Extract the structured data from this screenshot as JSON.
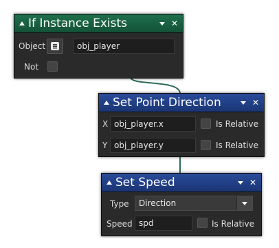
{
  "nodes": {
    "if_instance": {
      "title": "If Instance Exists",
      "object_label": "Object",
      "object_value": "obj_player",
      "not_label": "Not"
    },
    "set_point_direction": {
      "title": "Set Point Direction",
      "x_label": "X",
      "x_value": "obj_player.x",
      "x_relative_label": "Is Relative",
      "y_label": "Y",
      "y_value": "obj_player.y",
      "y_relative_label": "Is Relative"
    },
    "set_speed": {
      "title": "Set Speed",
      "type_label": "Type",
      "type_value": "Direction",
      "speed_label": "Speed",
      "speed_value": "spd",
      "speed_relative_label": "Is Relative"
    }
  },
  "colors": {
    "header_green": "#1f6f4c",
    "header_blue": "#2a4b9a",
    "node_body": "#2a2a2a",
    "connector": "#2f6b55"
  },
  "icons": [
    "collapse-arrow-icon",
    "menu-chevron-icon",
    "close-icon",
    "object-picker-icon",
    "dropdown-arrow-icon"
  ]
}
